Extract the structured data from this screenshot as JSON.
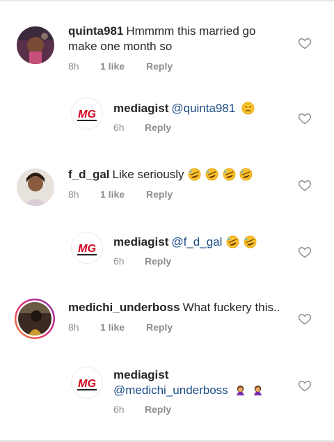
{
  "comments": [
    {
      "username": "quinta981",
      "text": "Hmmmm this married go make one month so",
      "time": "8h",
      "likes": "1 like",
      "reply": "Reply"
    },
    {
      "username": "mediagist",
      "mention": "@quinta981",
      "emoji": "worried-face",
      "time": "6h",
      "reply": "Reply"
    },
    {
      "username": "f_d_gal",
      "text": "Like seriously",
      "emoji": "rofl-face",
      "time": "8h",
      "likes": "1 like",
      "reply": "Reply"
    },
    {
      "username": "mediagist",
      "mention": "@f_d_gal",
      "emoji": "rofl-face",
      "time": "6h",
      "reply": "Reply"
    },
    {
      "username": "medichi_underboss",
      "text": "What fuckery this..",
      "time": "8h",
      "likes": "1 like",
      "reply": "Reply"
    },
    {
      "username": "mediagist",
      "mention": "@medichi_underboss",
      "emoji": "woman-facepalming",
      "time": "6h",
      "reply": "Reply"
    }
  ],
  "brand": {
    "logo_text": "MG"
  },
  "colors": {
    "mention": "#1a4c84",
    "meta": "#8e8e8e",
    "text": "#262626",
    "story_ring": [
      "#f58529",
      "#dd2a7b",
      "#8134af"
    ]
  }
}
